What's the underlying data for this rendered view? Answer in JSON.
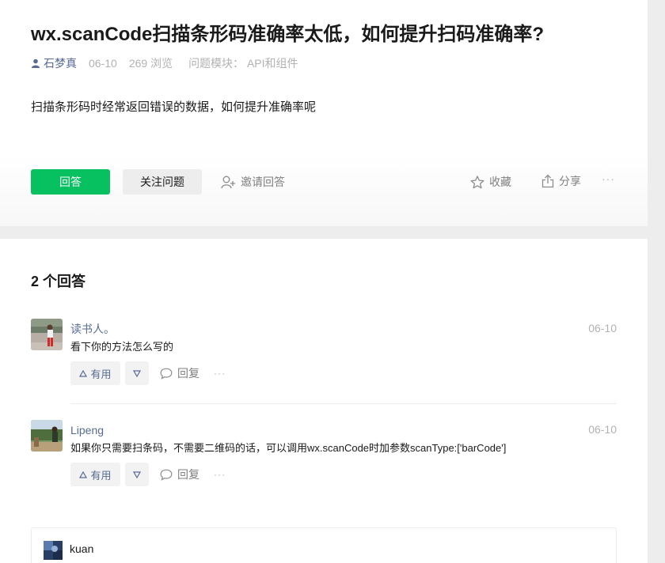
{
  "question": {
    "title": "wx.scanCode扫描条形码准确率太低，如何提升扫码准确率?",
    "author": "石梦真",
    "date": "06-10",
    "views": "269 浏览",
    "module": "问题模块：  API和组件",
    "body": "扫描条形码时经常返回错误的数据，如何提升准确率呢",
    "actions": {
      "answer": "回答",
      "follow": "关注问题",
      "invite": "邀请回答",
      "favorite": "收藏",
      "share": "分享",
      "more": "···"
    }
  },
  "answers_header": "2 个回答",
  "answers": [
    {
      "name": "读书人。",
      "date": "06-10",
      "text": "看下你的方法怎么写的",
      "useful": "有用",
      "reply": "回复",
      "more": "···"
    },
    {
      "name": "Lipeng",
      "date": "06-10",
      "text": "如果你只需要扫条码，不需要二维码的话，可以调用wx.scanCode时加参数scanType:['barCode']",
      "useful": "有用",
      "reply": "回复",
      "more": "···"
    }
  ],
  "comment": {
    "name": "kuan"
  },
  "colors": {
    "primary_green": "#07c160",
    "link_blue": "#576b95",
    "muted_gray": "#b2b2b2",
    "background": "#ededed"
  },
  "icons": [
    "user-icon",
    "add-user-icon",
    "star-icon",
    "share-icon",
    "thumb-up-icon",
    "thumb-down-icon",
    "comment-icon"
  ]
}
